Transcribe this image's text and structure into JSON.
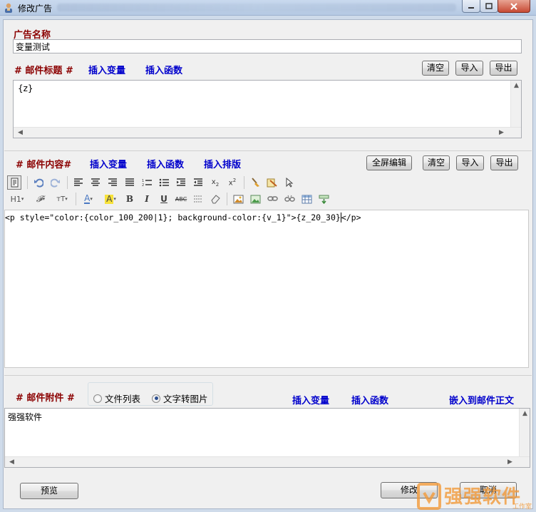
{
  "window": {
    "title": "修改广告"
  },
  "ad_name": {
    "label": "广告名称",
    "value": "变量测试"
  },
  "subject": {
    "label": "# 邮件标题 #",
    "insert_variable": "插入变量",
    "insert_function": "插入函数",
    "clear": "清空",
    "import": "导入",
    "export": "导出",
    "content": "{z}"
  },
  "body": {
    "label": "# 邮件内容#",
    "insert_variable": "插入变量",
    "insert_function": "插入函数",
    "insert_layout": "插入排版",
    "fullscreen": "全屏编辑",
    "clear": "清空",
    "import": "导入",
    "export": "导出",
    "code_before_cursor": "<p style=\"color:{color_100_200|1}; background-color:{v_1}\">{z_20_30}",
    "code_after_cursor": "</p>",
    "toolbar": {
      "row1": [
        "source-icon",
        "undo-icon",
        "redo-icon",
        "align-left-icon",
        "align-center-icon",
        "align-right-icon",
        "align-justify-icon",
        "ordered-list-icon",
        "unordered-list-icon",
        "indent-icon",
        "outdent-icon",
        "subscript-icon",
        "superscript-icon",
        "clean-icon",
        "paste-word-icon",
        "select-icon"
      ],
      "row2_text": {
        "heading": "H1",
        "font": "𝓕",
        "size": "тT",
        "color": "A",
        "highlight": "A",
        "bold": "B",
        "italic": "I",
        "underline": "U",
        "strike": "ABC"
      }
    }
  },
  "attachment": {
    "label": "# 邮件附件 #",
    "opt_file_list": "文件列表",
    "opt_text_image": "文字转图片",
    "selected": "文字转图片",
    "insert_variable": "插入变量",
    "insert_function": "插入函数",
    "embed": "嵌入到邮件正文",
    "content": "强强软件"
  },
  "footer": {
    "preview": "预览",
    "modify": "修改",
    "cancel": "取消"
  },
  "watermark": {
    "text": "强强软件",
    "sub": "工作室"
  },
  "colors": {
    "label_red": "#8b0000",
    "link_blue": "#0000cc",
    "watermark_orange": "#f29a3a"
  }
}
